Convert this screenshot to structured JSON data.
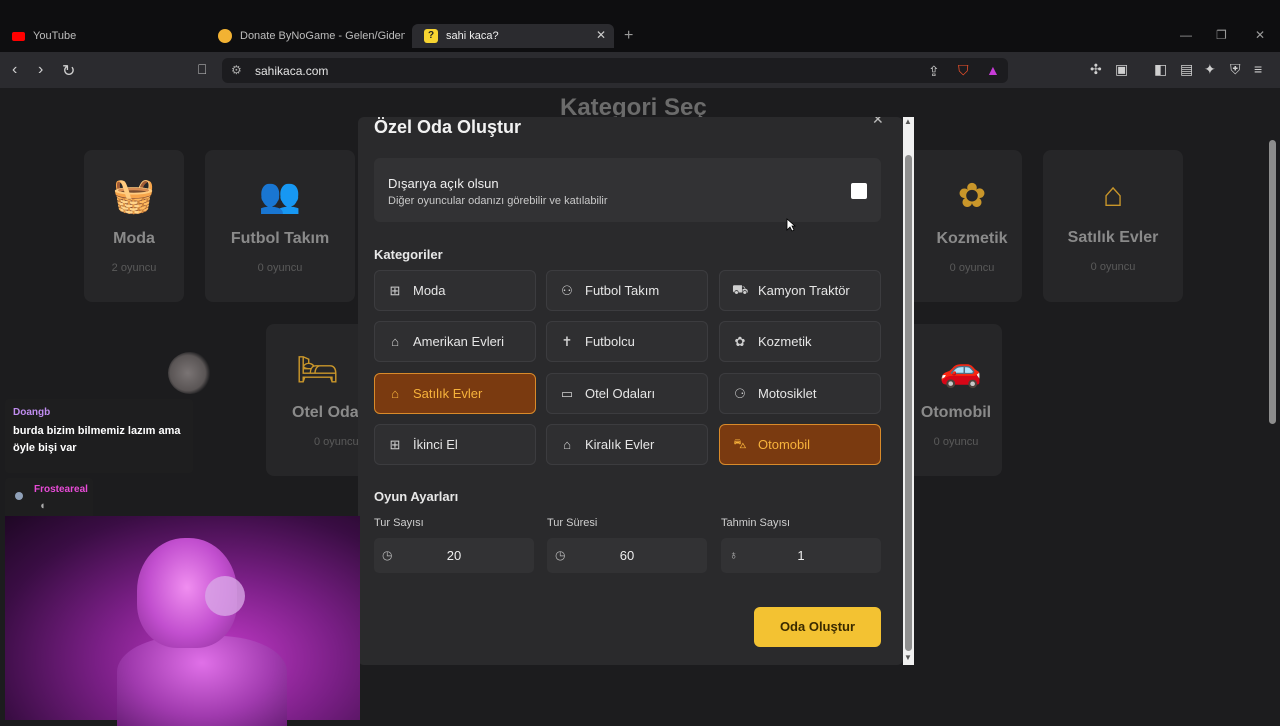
{
  "browser": {
    "tabs": [
      {
        "title": "YouTube",
        "favicon_color": "#ff0000"
      },
      {
        "title": "Donate ByNoGame - Gelen/Giden Ba",
        "favicon_color": "#f2b233"
      },
      {
        "title": "sahi kaca?",
        "favicon_color": "#f7d431",
        "favicon_text": "?"
      }
    ],
    "url": "sahikaca.com",
    "new_tab": "+",
    "close": "✕"
  },
  "page": {
    "title": "Kategori Seç",
    "cards": [
      {
        "name": "Moda",
        "count": "2 oyuncu",
        "icon": "basket-icon",
        "glyph": "🧺"
      },
      {
        "name": "Futbol Takım",
        "count": "0 oyuncu",
        "icon": "users-icon",
        "glyph": "👥"
      },
      {
        "name": "Kozmetik",
        "count": "0 oyuncu",
        "icon": "flower-icon",
        "glyph": "✿"
      },
      {
        "name": "Satılık Evler",
        "count": "0 oyuncu",
        "icon": "house-plus-icon",
        "glyph": "⌂"
      },
      {
        "name": "Otel Odaları",
        "count": "0 oyuncu",
        "icon": "bed-icon",
        "glyph": "🛏"
      },
      {
        "name": "Otomobil",
        "count": "0 oyuncu",
        "icon": "car-icon",
        "glyph": "🚗"
      }
    ]
  },
  "modal": {
    "title": "Özel Oda Oluştur",
    "public": {
      "title": "Dışarıya açık olsun",
      "description": "Diğer oyuncular odanızı görebilir ve katılabilir"
    },
    "categories_label": "Kategoriler",
    "categories": [
      {
        "label": "Moda",
        "icon": "basket-icon",
        "glyph": "⊞",
        "selected": false
      },
      {
        "label": "Futbol Takım",
        "icon": "users-icon",
        "glyph": "⚇",
        "selected": false
      },
      {
        "label": "Kamyon Traktör",
        "icon": "truck-icon",
        "glyph": "⛟",
        "selected": false
      },
      {
        "label": "Amerikan Evleri",
        "icon": "house-icon",
        "glyph": "⌂",
        "selected": false
      },
      {
        "label": "Futbolcu",
        "icon": "person-icon",
        "glyph": "✝",
        "selected": false
      },
      {
        "label": "Kozmetik",
        "icon": "flower-icon",
        "glyph": "✿",
        "selected": false
      },
      {
        "label": "Satılık Evler",
        "icon": "house-plus-icon",
        "glyph": "⌂",
        "selected": true
      },
      {
        "label": "Otel Odaları",
        "icon": "bed-icon",
        "glyph": "▭",
        "selected": false
      },
      {
        "label": "Motosiklet",
        "icon": "motorcycle-icon",
        "glyph": "⚆",
        "selected": false
      },
      {
        "label": "İkinci El",
        "icon": "basket-icon",
        "glyph": "⊞",
        "selected": false
      },
      {
        "label": "Kiralık Evler",
        "icon": "house-icon",
        "glyph": "⌂",
        "selected": false
      },
      {
        "label": "Otomobil",
        "icon": "car-icon",
        "glyph": "⛍",
        "selected": true
      }
    ],
    "settings_label": "Oyun Ayarları",
    "settings": [
      {
        "label": "Tur Sayısı",
        "value": "20",
        "icon": "clock-icon",
        "glyph": "◷"
      },
      {
        "label": "Tur Süresi",
        "value": "60",
        "icon": "clock-icon",
        "glyph": "◷"
      },
      {
        "label": "Tahmin Sayısı",
        "value": "1",
        "icon": "bulb-icon",
        "glyph": "♁"
      }
    ],
    "create_button": "Oda Oluştur"
  },
  "stream": {
    "chat": [
      {
        "user": "Doangb",
        "message": "burda bizim bilmemiz lazım ama öyle bişi var"
      },
      {
        "user": "Frosteareal",
        "message": ""
      }
    ]
  }
}
